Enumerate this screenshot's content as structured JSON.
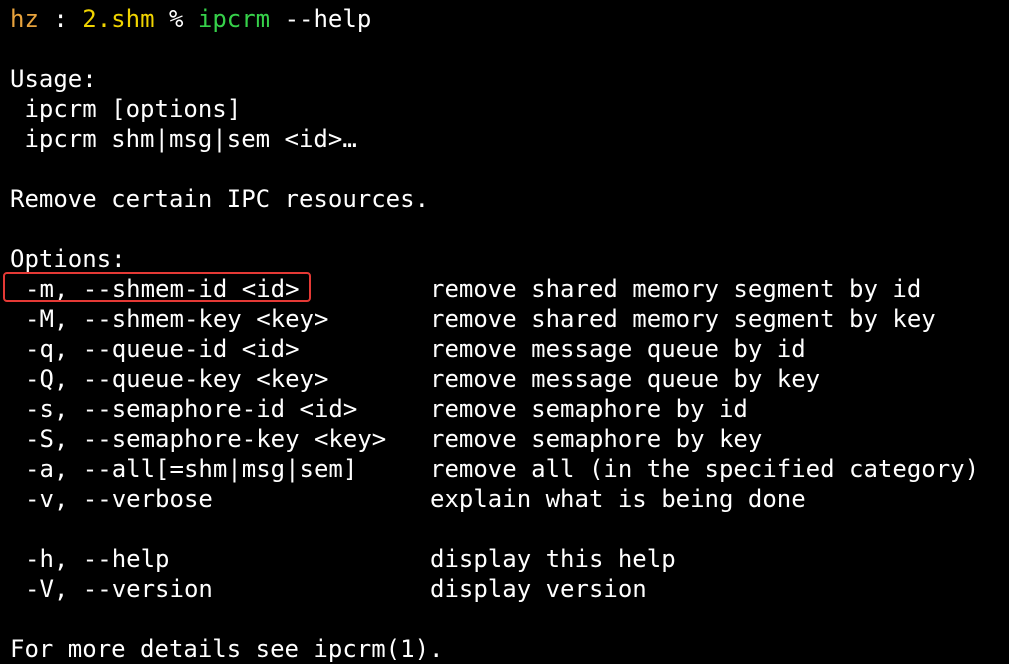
{
  "prompt": {
    "user": "hz",
    "separator": " : ",
    "directory": "2.shm",
    "symbol": " % ",
    "command": "ipcrm",
    "args": " --help"
  },
  "usage": {
    "heading": "Usage:",
    "lines": [
      " ipcrm [options]",
      " ipcrm shm|msg|sem <id>…"
    ]
  },
  "description": "Remove certain IPC resources.",
  "options_heading": "Options:",
  "options": [
    {
      "flag": "-m, --shmem-id <id>",
      "desc": "remove shared memory segment by id"
    },
    {
      "flag": "-M, --shmem-key <key>",
      "desc": "remove shared memory segment by key"
    },
    {
      "flag": "-q, --queue-id <id>",
      "desc": "remove message queue by id"
    },
    {
      "flag": "-Q, --queue-key <key>",
      "desc": "remove message queue by key"
    },
    {
      "flag": "-s, --semaphore-id <id>",
      "desc": "remove semaphore by id"
    },
    {
      "flag": "-S, --semaphore-key <key>",
      "desc": "remove semaphore by key"
    },
    {
      "flag": "-a, --all[=shm|msg|sem]",
      "desc": "remove all (in the specified category)"
    },
    {
      "flag": "-v, --verbose",
      "desc": "explain what is being done"
    }
  ],
  "help_options": [
    {
      "flag": "-h, --help",
      "desc": "display this help"
    },
    {
      "flag": "-V, --version",
      "desc": "display version"
    }
  ],
  "footer": "For more details see ipcrm(1).",
  "colors": {
    "background": "#000000",
    "text": "#ffffff",
    "user": "#e8a33d",
    "directory": "#f0d400",
    "command": "#36d14a",
    "highlight": "#e53935"
  }
}
